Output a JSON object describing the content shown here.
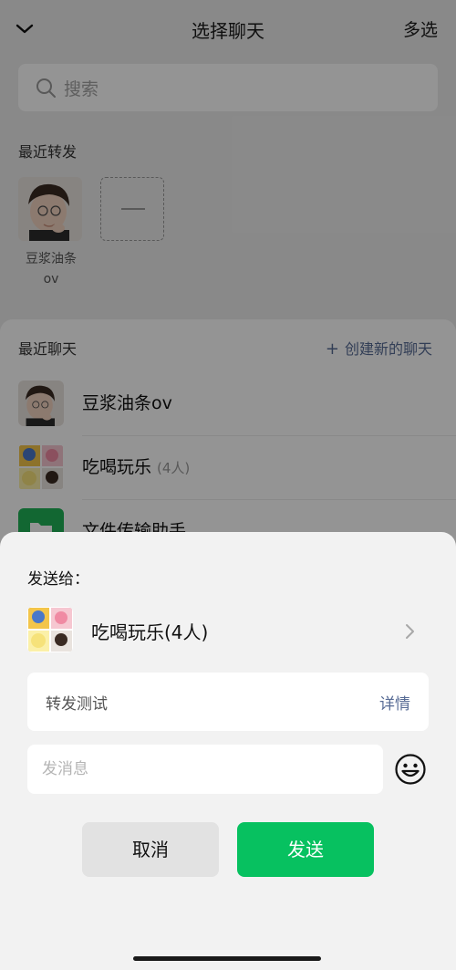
{
  "navbar": {
    "title": "选择聊天",
    "multi_select": "多选"
  },
  "search": {
    "placeholder": "搜索"
  },
  "recent_forward": {
    "title": "最近转发",
    "contact_name_line1": "豆浆油条",
    "contact_name_line2": "ov"
  },
  "recent_chats": {
    "title": "最近聊天",
    "new_chat": "创建新的聊天",
    "items": [
      {
        "name": "豆浆油条ov",
        "count": ""
      },
      {
        "name": "吃喝玩乐",
        "count": "(4人)"
      },
      {
        "name": "文件传输助手",
        "count": ""
      }
    ]
  },
  "sheet": {
    "send_to_label": "发送给：",
    "target_name": "吃喝玩乐(4人)",
    "preview_text": "转发测试",
    "detail_label": "详情",
    "message_placeholder": "发消息",
    "cancel_label": "取消",
    "send_label": "发送"
  },
  "colors": {
    "accent_green": "#07c160",
    "link_blue": "#576b95",
    "file_icon_green": "#20b257"
  }
}
